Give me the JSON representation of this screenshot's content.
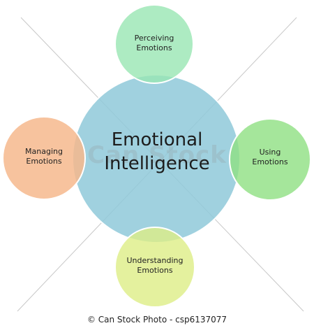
{
  "diagram": {
    "center": {
      "line1": "Emotional",
      "line2": "Intelligence",
      "color": "#8fc9d9"
    },
    "nodes": [
      {
        "id": "perceiving",
        "line1": "Perceiving",
        "line2": "Emotions",
        "color": "#99e6b3"
      },
      {
        "id": "using",
        "line1": "Using",
        "line2": "Emotions",
        "color": "#8ee082"
      },
      {
        "id": "understanding",
        "line1": "Understanding",
        "line2": "Emotions",
        "color": "#dded86"
      },
      {
        "id": "managing",
        "line1": "Managing",
        "line2": "Emotions",
        "color": "#f6b98d"
      }
    ]
  },
  "watermark": "Can Stock",
  "footer": "© Can Stock Photo - csp6137077"
}
